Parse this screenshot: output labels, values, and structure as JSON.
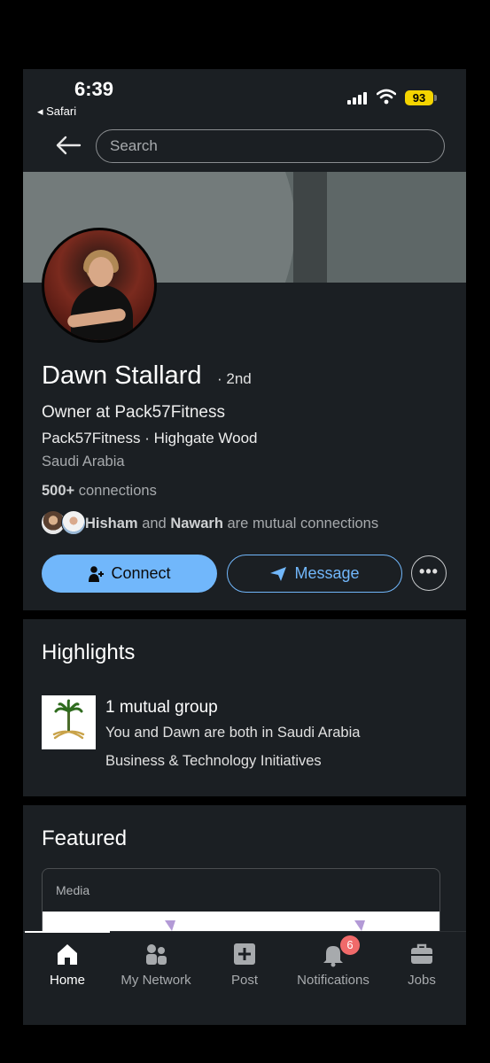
{
  "status_bar": {
    "time": "6:39",
    "back_app": "◂ Safari",
    "battery": "93"
  },
  "search": {
    "placeholder": "Search"
  },
  "profile": {
    "name": "Dawn Stallard",
    "degree": "· 2nd",
    "headline": "Owner at Pack57Fitness",
    "company_line": "Pack57Fitness · Highgate Wood",
    "location": "Saudi Arabia",
    "connections_count": "500+",
    "connections_label": " connections",
    "mutual_name_1": "Hisham",
    "mutual_and": " and ",
    "mutual_name_2": "Nawarh",
    "mutual_suffix": " are mutual connections"
  },
  "actions": {
    "connect_label": "Connect",
    "message_label": "Message",
    "more_label": "•••"
  },
  "highlights": {
    "title": "Highlights",
    "group_title": "1 mutual group",
    "group_desc": "You and Dawn are both in Saudi Arabia",
    "group_name": "Business & Technology Initiatives"
  },
  "featured": {
    "title": "Featured",
    "media_label": "Media"
  },
  "tabbar": {
    "items": [
      {
        "label": "Home",
        "icon": "home-icon"
      },
      {
        "label": "My Network",
        "icon": "network-icon"
      },
      {
        "label": "Post",
        "icon": "post-icon"
      },
      {
        "label": "Notifications",
        "icon": "bell-icon",
        "badge": "6"
      },
      {
        "label": "Jobs",
        "icon": "briefcase-icon"
      }
    ]
  },
  "colors": {
    "accent": "#71b7fb",
    "background": "#1b1f23",
    "badge": "#f06a6a",
    "battery": "#f5d400"
  }
}
